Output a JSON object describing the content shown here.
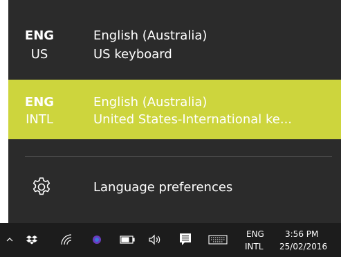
{
  "languages": [
    {
      "code_top": "ENG",
      "code_bottom": "US",
      "language": "English (Australia)",
      "keyboard": "US keyboard",
      "selected": false
    },
    {
      "code_top": "ENG",
      "code_bottom": "INTL",
      "language": "English (Australia)",
      "keyboard": "United States-International ke...",
      "selected": true
    }
  ],
  "preferences": {
    "label": "Language preferences",
    "icon": "gear-icon"
  },
  "taskbar": {
    "input_indicator": {
      "top": "ENG",
      "bottom": "INTL"
    },
    "clock": {
      "time": "3:56 PM",
      "date": "25/02/2016"
    },
    "icons": [
      "chevron-up-icon",
      "dropbox-icon",
      "wifi-icon",
      "app-tray-icon",
      "battery-icon",
      "volume-icon",
      "action-center-icon",
      "touch-keyboard-icon"
    ]
  },
  "colors": {
    "flyout_bg": "#2b2b2b",
    "selected_bg": "#cdd53d",
    "taskbar_bg": "#1c1c1c",
    "text": "#ffffff"
  }
}
